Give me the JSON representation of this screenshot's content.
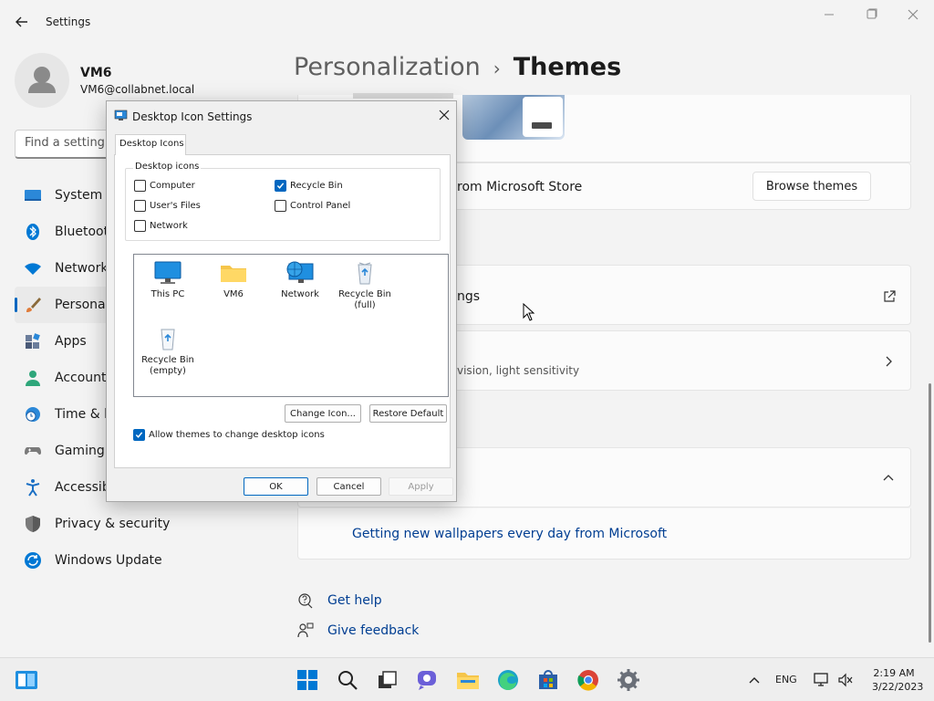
{
  "window": {
    "app_title": "Settings",
    "back_icon": "arrow-left-icon",
    "controls": [
      "minimize-icon",
      "maximize-icon",
      "close-icon"
    ]
  },
  "user": {
    "name": "VM6",
    "email": "VM6@collabnet.local"
  },
  "search": {
    "placeholder": "Find a setting"
  },
  "sidebar": {
    "items": [
      {
        "label": "System",
        "icon": "monitor-icon"
      },
      {
        "label": "Bluetooth",
        "icon": "bluetooth-icon"
      },
      {
        "label": "Network",
        "icon": "wifi-icon"
      },
      {
        "label": "Personali",
        "icon": "paintbrush-icon",
        "active": true
      },
      {
        "label": "Apps",
        "icon": "apps-grid-icon"
      },
      {
        "label": "Accounts",
        "icon": "person-icon"
      },
      {
        "label": "Time & la",
        "icon": "clock-globe-icon"
      },
      {
        "label": "Gaming",
        "icon": "gamepad-icon"
      },
      {
        "label": "Accessibi",
        "icon": "accessibility-icon"
      },
      {
        "label": "Privacy & security",
        "icon": "shield-icon"
      },
      {
        "label": "Windows Update",
        "icon": "update-icon"
      }
    ]
  },
  "breadcrumb": {
    "parent": "Personalization",
    "separator": "›",
    "current": "Themes"
  },
  "main": {
    "store_text": "rom Microsoft Store",
    "browse_button": "Browse themes",
    "desktop_icons_text": "ngs",
    "contrast_subtitle": "vision, light sensitivity",
    "spotlight_link": "Getting new wallpapers every day from Microsoft",
    "get_help": "Get help",
    "give_feedback": "Give feedback"
  },
  "dialog": {
    "title": "Desktop Icon Settings",
    "tab": "Desktop Icons",
    "group_label": "Desktop icons",
    "checkboxes": [
      {
        "label": "Computer",
        "checked": false
      },
      {
        "label": "User's Files",
        "checked": false
      },
      {
        "label": "Network",
        "checked": false
      },
      {
        "label": "Recycle Bin",
        "checked": true
      },
      {
        "label": "Control Panel",
        "checked": false
      }
    ],
    "icons": [
      {
        "label": "This PC"
      },
      {
        "label": "VM6"
      },
      {
        "label": "Network"
      },
      {
        "label": "Recycle Bin (full)"
      },
      {
        "label": "Recycle Bin (empty)"
      }
    ],
    "change_icon": "Change Icon...",
    "restore_default": "Restore Default",
    "allow_themes": "Allow themes to change desktop icons",
    "allow_themes_checked": true,
    "ok": "OK",
    "cancel": "Cancel",
    "apply": "Apply"
  },
  "taskbar": {
    "language": "ENG",
    "time": "2:19 AM",
    "date": "3/22/2023",
    "apps": [
      "widgets-icon",
      "start-icon",
      "search-icon",
      "task-view-icon",
      "chat-icon",
      "file-explorer-icon",
      "edge-icon",
      "store-icon",
      "chrome-icon",
      "settings-gear-icon"
    ]
  },
  "colors": {
    "accent": "#0067c0",
    "link": "#003e92"
  }
}
